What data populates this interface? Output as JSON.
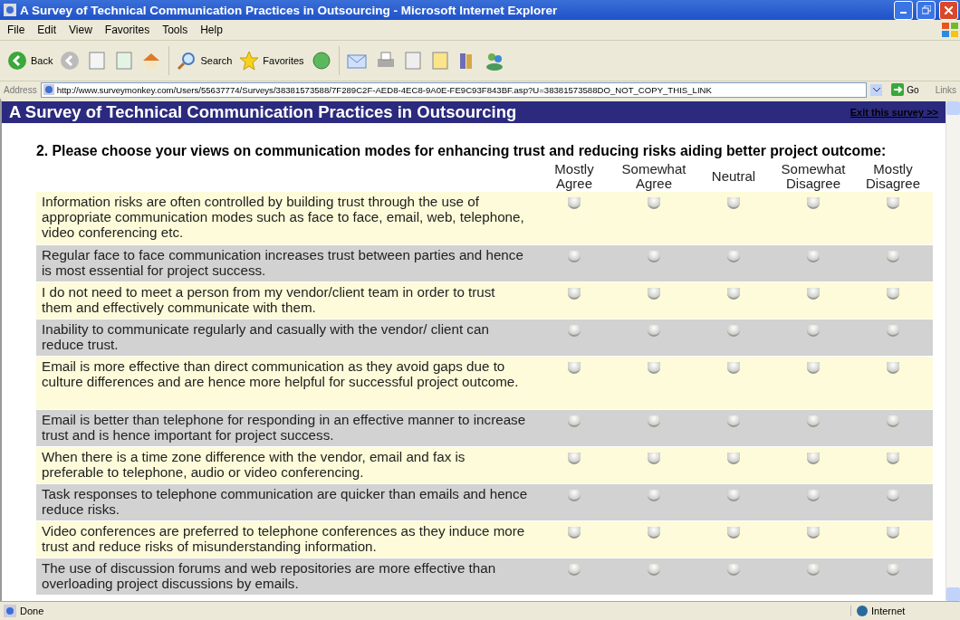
{
  "window": {
    "title": "A Survey of Technical Communication Practices in Outsourcing - Microsoft Internet Explorer"
  },
  "menu": [
    "File",
    "Edit",
    "View",
    "Favorites",
    "Tools",
    "Help"
  ],
  "toolbar": {
    "back": "Back",
    "search": "Search",
    "favorites": "Favorites"
  },
  "address": {
    "label": "Address",
    "url": "http://www.surveymonkey.com/Users/55637774/Surveys/38381573588/7F289C2F-AED8-4EC8-9A0E-FE9C93F843BF.asp?U=38381573588DO_NOT_COPY_THIS_LINK",
    "go": "Go",
    "links": "Links"
  },
  "survey": {
    "title": "A Survey of Technical Communication Practices in Outsourcing",
    "exit": "Exit this survey >>",
    "question": "2. Please choose your views on communication modes for enhancing trust and reducing risks aiding better project outcome:",
    "columns": [
      "Mostly Agree",
      "Somewhat Agree",
      "Neutral",
      "Somewhat Disagree",
      "Mostly Disagree"
    ],
    "rows": [
      {
        "text": "Information risks are often controlled by building trust through the use of appropriate communication modes such as face to face, email, web, telephone, video conferencing etc.",
        "answers": [
          {
            "selected": false
          },
          {
            "selected": false
          },
          {
            "selected": false
          },
          {
            "selected": false
          },
          {
            "selected": false
          }
        ]
      },
      {
        "text": "Regular face to face communication increases trust between parties and hence is most essential for project success.",
        "answers": [
          {
            "selected": false
          },
          {
            "selected": false
          },
          {
            "selected": false
          },
          {
            "selected": false
          },
          {
            "selected": false
          }
        ]
      },
      {
        "text": "I do not need to meet a person from my vendor/client team in order to trust them and effectively communicate with them.",
        "answers": [
          {
            "selected": false
          },
          {
            "selected": false
          },
          {
            "selected": false
          },
          {
            "selected": false
          },
          {
            "selected": false
          }
        ]
      },
      {
        "text": "Inability to communicate regularly and casually with the vendor/ client can reduce trust.",
        "answers": [
          {
            "selected": false
          },
          {
            "selected": false
          },
          {
            "selected": false
          },
          {
            "selected": false
          },
          {
            "selected": false
          }
        ]
      },
      {
        "text": "Email is more effective than direct communication as they avoid gaps due to culture differences and are hence more helpful for successful project outcome.",
        "answers": [
          {
            "selected": false
          },
          {
            "selected": false
          },
          {
            "selected": false
          },
          {
            "selected": false
          },
          {
            "selected": false
          }
        ]
      },
      {
        "text": "Email is better than telephone for responding in an effective manner to increase trust and is hence important for project success.",
        "answers": [
          {
            "selected": false
          },
          {
            "selected": false
          },
          {
            "selected": false
          },
          {
            "selected": false
          },
          {
            "selected": false
          }
        ]
      },
      {
        "text": "When there is a time zone difference with the vendor, email and fax is preferable to telephone, audio or video conferencing.",
        "answers": [
          {
            "selected": false
          },
          {
            "selected": false
          },
          {
            "selected": false
          },
          {
            "selected": false
          },
          {
            "selected": false
          }
        ]
      },
      {
        "text": "Task responses to telephone communication are quicker than emails and hence reduce risks.",
        "answers": [
          {
            "selected": false
          },
          {
            "selected": false
          },
          {
            "selected": false
          },
          {
            "selected": false
          },
          {
            "selected": false
          }
        ]
      },
      {
        "text": "Video conferences are preferred to telephone conferences as they induce more trust and reduce risks of misunderstanding information.",
        "answers": [
          {
            "selected": false
          },
          {
            "selected": false
          },
          {
            "selected": false
          },
          {
            "selected": false
          },
          {
            "selected": false
          }
        ]
      },
      {
        "text": "The use of discussion forums and web repositories are more effective than overloading project discussions by emails.",
        "answers": [
          {
            "selected": false
          },
          {
            "selected": false
          },
          {
            "selected": false
          },
          {
            "selected": false
          },
          {
            "selected": false
          }
        ]
      }
    ]
  },
  "status_bar": {
    "status": "Done",
    "zone": "Internet"
  }
}
